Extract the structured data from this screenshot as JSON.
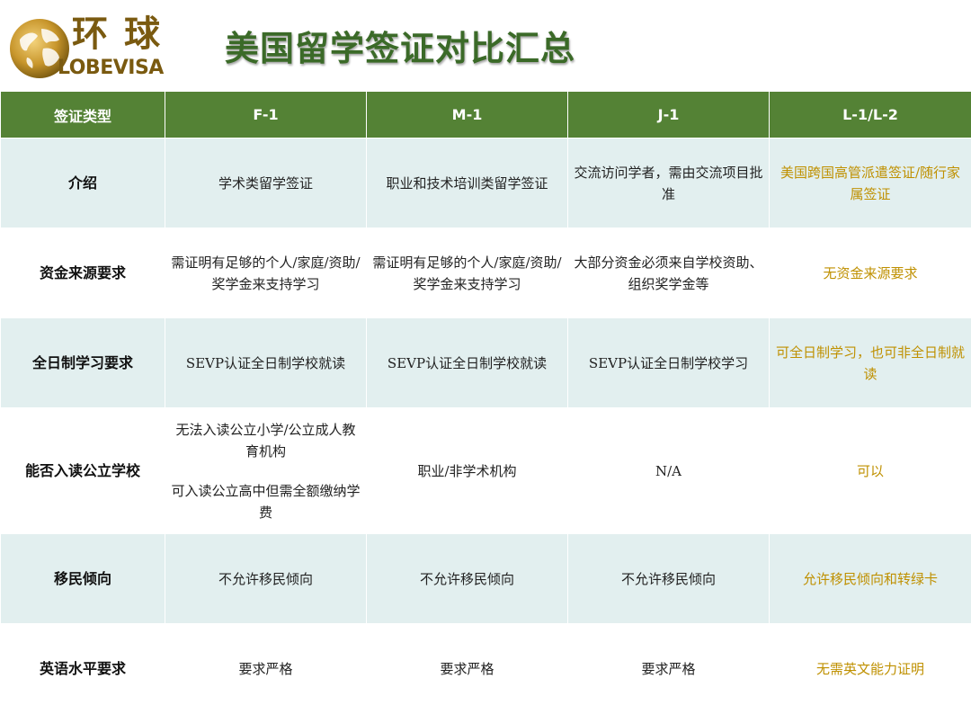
{
  "header": {
    "logo_cn": "环球",
    "logo_en": "LOBEVISA",
    "title": "美国留学签证对比汇总"
  },
  "table": {
    "columns": [
      "签证类型",
      "F-1",
      "M-1",
      "J-1",
      "L-1/L-2"
    ],
    "rows": [
      {
        "label": "介绍",
        "cells": [
          [
            "学术类留学签证"
          ],
          [
            "职业和技术培训类留学签证"
          ],
          [
            "交流访问学者，需由交流项目批准"
          ],
          [
            "美国跨国高管派遣签证/随行家属签证"
          ]
        ]
      },
      {
        "label": "资金来源要求",
        "cells": [
          [
            "需证明有足够的个人/家庭/资助/奖学金来支持学习"
          ],
          [
            "需证明有足够的个人/家庭/资助/奖学金来支持学习"
          ],
          [
            "大部分资金必须来自学校资助、组织奖学金等"
          ],
          [
            "无资金来源要求"
          ]
        ]
      },
      {
        "label": "全日制学习要求",
        "cells": [
          [
            "SEVP认证全日制学校就读"
          ],
          [
            "SEVP认证全日制学校就读"
          ],
          [
            "SEVP认证全日制学校学习"
          ],
          [
            "可全日制学习，也可非全日制就读"
          ]
        ]
      },
      {
        "label": "能否入读公立学校",
        "cells": [
          [
            "无法入读公立小学/公立成人教育机构",
            "可入读公立高中但需全额缴纳学费"
          ],
          [
            "职业/非学术机构"
          ],
          [
            "N/A"
          ],
          [
            "可以"
          ]
        ]
      },
      {
        "label": "移民倾向",
        "cells": [
          [
            "不允许移民倾向"
          ],
          [
            "不允许移民倾向"
          ],
          [
            "不允许移民倾向"
          ],
          [
            "允许移民倾向和转绿卡"
          ]
        ]
      },
      {
        "label": "英语水平要求",
        "cells": [
          [
            "要求严格"
          ],
          [
            "要求严格"
          ],
          [
            "要求严格"
          ],
          [
            "无需英文能力证明"
          ]
        ]
      }
    ]
  },
  "colors": {
    "header_green": "#548235",
    "title_green": "#3b6a28",
    "row_tint": "#e2efef",
    "highlight_gold": "#bf9000",
    "logo_gold": "#7a5a10"
  }
}
